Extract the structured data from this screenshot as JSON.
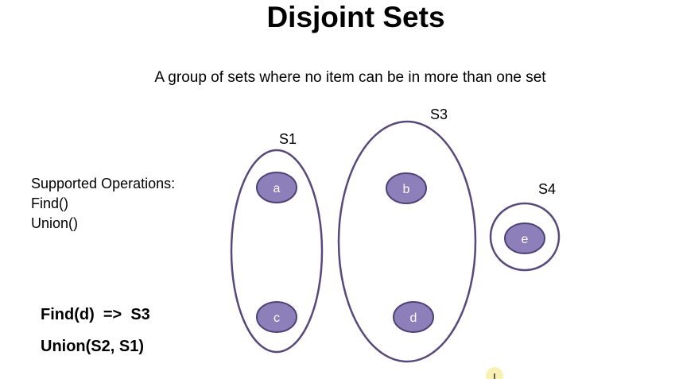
{
  "title": "Disjoint Sets",
  "subtitle": "A group of sets where no item can be in more than one set",
  "operations": {
    "heading": "Supported Operations:",
    "items": [
      "Find()",
      "Union()"
    ]
  },
  "examples": [
    "Find(d)  =>  S3",
    "Union(S2, S1)"
  ],
  "colors": {
    "set_outline": "#57497a",
    "item_fill": "#8c7fba",
    "item_stroke": "#4e4374",
    "item_text": "#ffffff",
    "cursor_highlight": "#f5ec9a"
  },
  "sets": [
    {
      "label": "S1",
      "items": [
        "a",
        "c"
      ]
    },
    {
      "label": "S3",
      "items": [
        "b",
        "d"
      ]
    },
    {
      "label": "S4",
      "items": [
        "e"
      ]
    }
  ]
}
